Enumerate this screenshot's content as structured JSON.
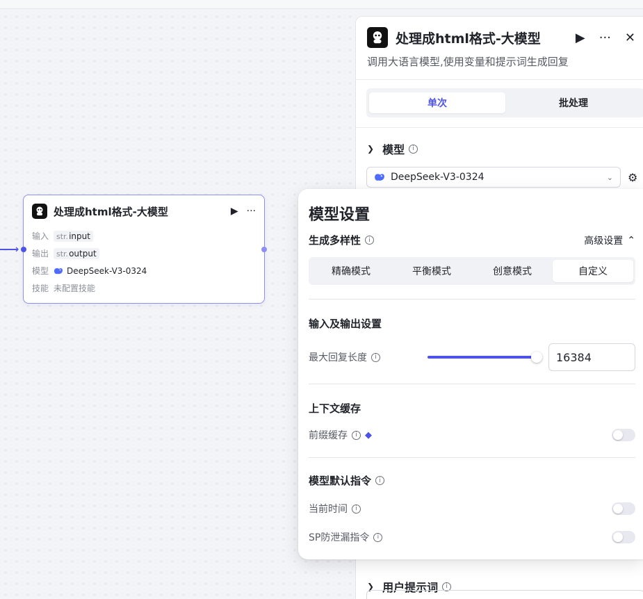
{
  "node": {
    "title": "处理成html格式-大模型",
    "rows": {
      "input_label": "输入",
      "input_type": "str.",
      "input_name": "input",
      "output_label": "输出",
      "output_type": "str.",
      "output_name": "output",
      "model_label": "模型",
      "model_name": "DeepSeek-V3-0324",
      "skill_label": "技能",
      "skill_value": "未配置技能"
    }
  },
  "panel": {
    "title": "处理成html格式-大模型",
    "description": "调用大语言模型,使用变量和提示词生成回复",
    "tabs": [
      "单次",
      "批处理"
    ],
    "active_tab": "单次",
    "model_section": "模型",
    "model_selected": "DeepSeek-V3-0324",
    "user_prompt_section": "用户提示词"
  },
  "popup": {
    "title": "模型设置",
    "diversity_label": "生成多样性",
    "advanced_label": "高级设置",
    "modes": [
      "精确模式",
      "平衡模式",
      "创意模式",
      "自定义"
    ],
    "active_mode": "自定义",
    "io_section": "输入及输出设置",
    "max_reply_label": "最大回复长度",
    "max_reply_value": "16384",
    "max_reply_fraction": 0.98,
    "context_section": "上下文缓存",
    "prefix_cache_label": "前缀缓存",
    "prefix_cache_on": false,
    "default_instr_section": "模型默认指令",
    "current_time_label": "当前时间",
    "current_time_on": false,
    "sp_leak_label": "SP防泄漏指令",
    "sp_leak_on": false
  },
  "colors": {
    "accent": "#4d53e8",
    "node_border": "#8c90f2"
  },
  "icons": [
    "bot-logo",
    "play-icon",
    "more-icon",
    "close-icon",
    "info-icon",
    "chevron-down-icon",
    "chevron-up-icon",
    "gear-icon",
    "deepseek-icon",
    "gem-icon"
  ]
}
